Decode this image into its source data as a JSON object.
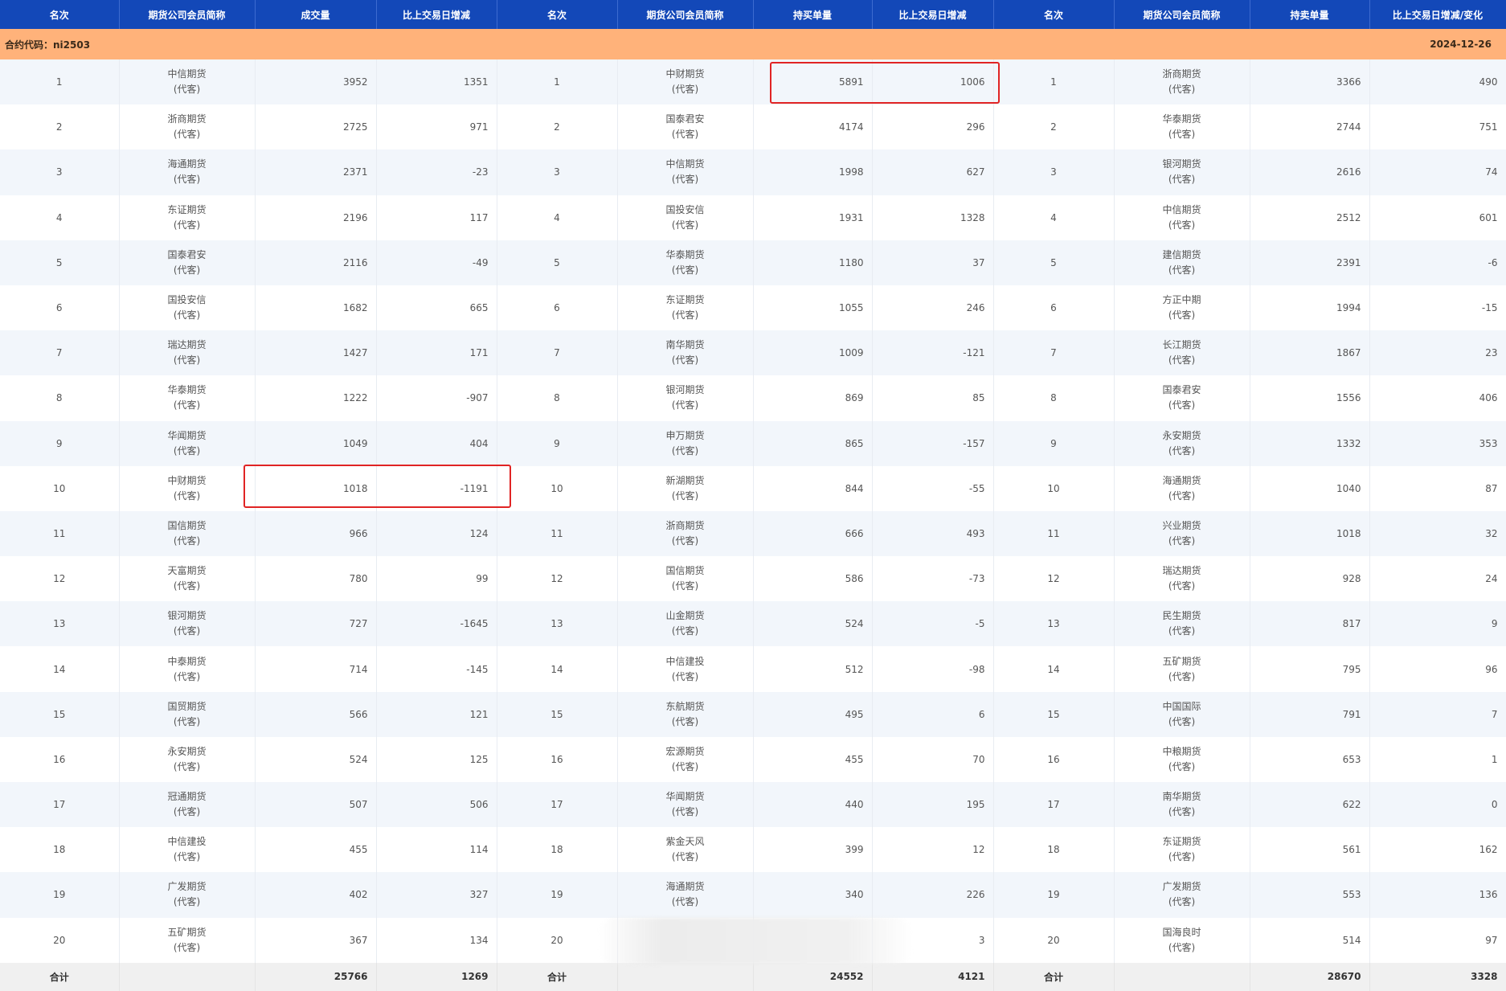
{
  "headers": [
    "名次",
    "期货公司会员简称",
    "成交量",
    "比上交易日增减",
    "名次",
    "期货公司会员简称",
    "持买单量",
    "比上交易日增减",
    "名次",
    "期货公司会员简称",
    "持卖单量",
    "比上交易日增减/变化"
  ],
  "contract_label": "合约代码：ni2503",
  "date": "2024-12-26",
  "agent_label": "(代客)",
  "rows": [
    {
      "r1": "1",
      "f1": "中信期货",
      "v1": "3952",
      "d1": "1351",
      "r2": "1",
      "f2": "中财期货",
      "v2": "5891",
      "d2": "1006",
      "r3": "1",
      "f3": "浙商期货",
      "v3": "3366",
      "d3": "490"
    },
    {
      "r1": "2",
      "f1": "浙商期货",
      "v1": "2725",
      "d1": "971",
      "r2": "2",
      "f2": "国泰君安",
      "v2": "4174",
      "d2": "296",
      "r3": "2",
      "f3": "华泰期货",
      "v3": "2744",
      "d3": "751"
    },
    {
      "r1": "3",
      "f1": "海通期货",
      "v1": "2371",
      "d1": "-23",
      "r2": "3",
      "f2": "中信期货",
      "v2": "1998",
      "d2": "627",
      "r3": "3",
      "f3": "银河期货",
      "v3": "2616",
      "d3": "74"
    },
    {
      "r1": "4",
      "f1": "东证期货",
      "v1": "2196",
      "d1": "117",
      "r2": "4",
      "f2": "国投安信",
      "v2": "1931",
      "d2": "1328",
      "r3": "4",
      "f3": "中信期货",
      "v3": "2512",
      "d3": "601"
    },
    {
      "r1": "5",
      "f1": "国泰君安",
      "v1": "2116",
      "d1": "-49",
      "r2": "5",
      "f2": "华泰期货",
      "v2": "1180",
      "d2": "37",
      "r3": "5",
      "f3": "建信期货",
      "v3": "2391",
      "d3": "-6"
    },
    {
      "r1": "6",
      "f1": "国投安信",
      "v1": "1682",
      "d1": "665",
      "r2": "6",
      "f2": "东证期货",
      "v2": "1055",
      "d2": "246",
      "r3": "6",
      "f3": "方正中期",
      "v3": "1994",
      "d3": "-15"
    },
    {
      "r1": "7",
      "f1": "瑞达期货",
      "v1": "1427",
      "d1": "171",
      "r2": "7",
      "f2": "南华期货",
      "v2": "1009",
      "d2": "-121",
      "r3": "7",
      "f3": "长江期货",
      "v3": "1867",
      "d3": "23"
    },
    {
      "r1": "8",
      "f1": "华泰期货",
      "v1": "1222",
      "d1": "-907",
      "r2": "8",
      "f2": "银河期货",
      "v2": "869",
      "d2": "85",
      "r3": "8",
      "f3": "国泰君安",
      "v3": "1556",
      "d3": "406"
    },
    {
      "r1": "9",
      "f1": "华闻期货",
      "v1": "1049",
      "d1": "404",
      "r2": "9",
      "f2": "申万期货",
      "v2": "865",
      "d2": "-157",
      "r3": "9",
      "f3": "永安期货",
      "v3": "1332",
      "d3": "353"
    },
    {
      "r1": "10",
      "f1": "中财期货",
      "v1": "1018",
      "d1": "-1191",
      "r2": "10",
      "f2": "新湖期货",
      "v2": "844",
      "d2": "-55",
      "r3": "10",
      "f3": "海通期货",
      "v3": "1040",
      "d3": "87"
    },
    {
      "r1": "11",
      "f1": "国信期货",
      "v1": "966",
      "d1": "124",
      "r2": "11",
      "f2": "浙商期货",
      "v2": "666",
      "d2": "493",
      "r3": "11",
      "f3": "兴业期货",
      "v3": "1018",
      "d3": "32"
    },
    {
      "r1": "12",
      "f1": "天富期货",
      "v1": "780",
      "d1": "99",
      "r2": "12",
      "f2": "国信期货",
      "v2": "586",
      "d2": "-73",
      "r3": "12",
      "f3": "瑞达期货",
      "v3": "928",
      "d3": "24"
    },
    {
      "r1": "13",
      "f1": "银河期货",
      "v1": "727",
      "d1": "-1645",
      "r2": "13",
      "f2": "山金期货",
      "v2": "524",
      "d2": "-5",
      "r3": "13",
      "f3": "民生期货",
      "v3": "817",
      "d3": "9"
    },
    {
      "r1": "14",
      "f1": "中泰期货",
      "v1": "714",
      "d1": "-145",
      "r2": "14",
      "f2": "中信建投",
      "v2": "512",
      "d2": "-98",
      "r3": "14",
      "f3": "五矿期货",
      "v3": "795",
      "d3": "96"
    },
    {
      "r1": "15",
      "f1": "国贸期货",
      "v1": "566",
      "d1": "121",
      "r2": "15",
      "f2": "东航期货",
      "v2": "495",
      "d2": "6",
      "r3": "15",
      "f3": "中国国际",
      "v3": "791",
      "d3": "7"
    },
    {
      "r1": "16",
      "f1": "永安期货",
      "v1": "524",
      "d1": "125",
      "r2": "16",
      "f2": "宏源期货",
      "v2": "455",
      "d2": "70",
      "r3": "16",
      "f3": "中粮期货",
      "v3": "653",
      "d3": "1"
    },
    {
      "r1": "17",
      "f1": "冠通期货",
      "v1": "507",
      "d1": "506",
      "r2": "17",
      "f2": "华闻期货",
      "v2": "440",
      "d2": "195",
      "r3": "17",
      "f3": "南华期货",
      "v3": "622",
      "d3": "0"
    },
    {
      "r1": "18",
      "f1": "中信建投",
      "v1": "455",
      "d1": "114",
      "r2": "18",
      "f2": "紫金天风",
      "v2": "399",
      "d2": "12",
      "r3": "18",
      "f3": "东证期货",
      "v3": "561",
      "d3": "162"
    },
    {
      "r1": "19",
      "f1": "广发期货",
      "v1": "402",
      "d1": "327",
      "r2": "19",
      "f2": "海通期货",
      "v2": "340",
      "d2": "226",
      "r3": "19",
      "f3": "广发期货",
      "v3": "553",
      "d3": "136"
    },
    {
      "r1": "20",
      "f1": "五矿期货",
      "v1": "367",
      "d1": "134",
      "r2": "20",
      "f2": "",
      "v2": "",
      "d2": "3",
      "r3": "20",
      "f3": "国海良时",
      "v3": "514",
      "d3": "97"
    }
  ],
  "totals": {
    "label": "合计",
    "v1": "25766",
    "d1": "1269",
    "v2": "24552",
    "d2": "4121",
    "v3": "28670",
    "d3": "3328"
  }
}
